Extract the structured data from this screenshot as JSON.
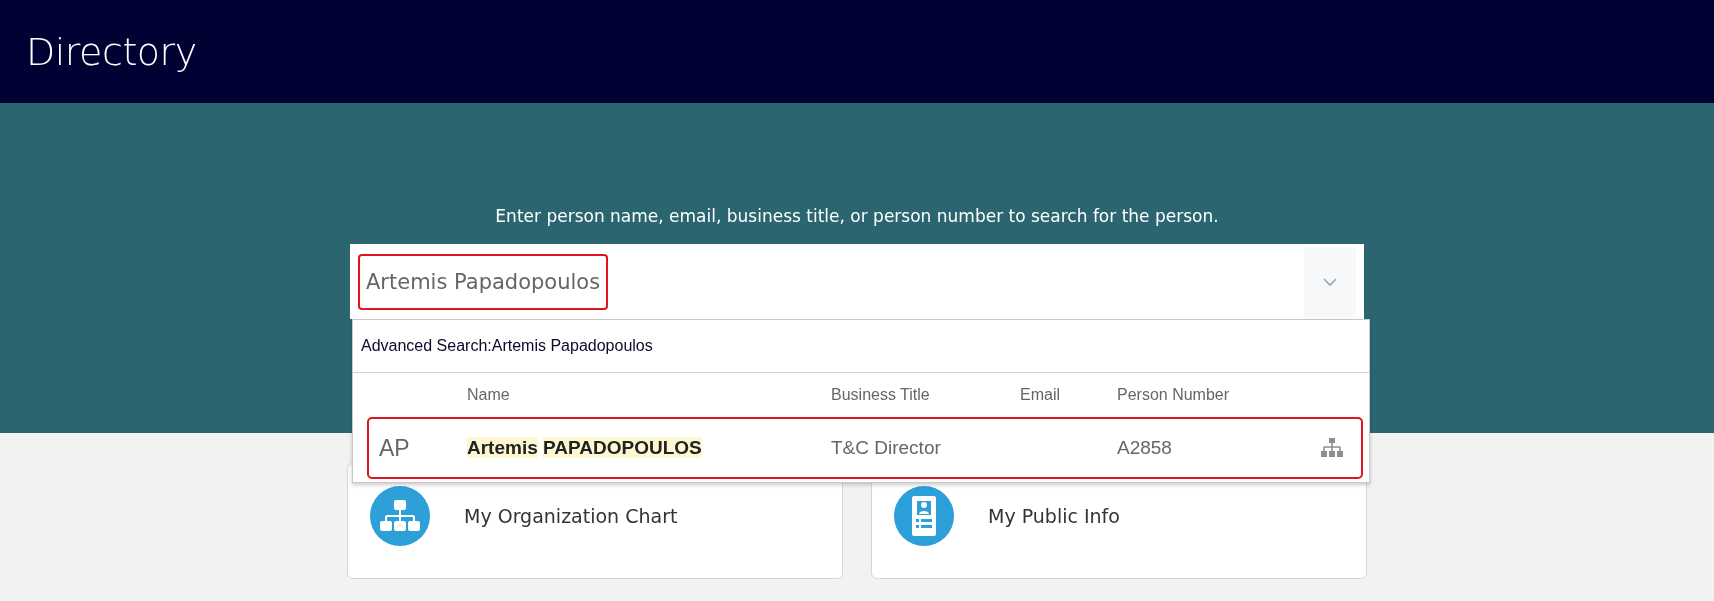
{
  "header": {
    "title": "Directory"
  },
  "search": {
    "hint": "Enter person name, email, business title, or person number to search for the person.",
    "value": "Artemis Papadopoulos",
    "expanded": true
  },
  "dropdown": {
    "advanced_search": "Advanced Search:Artemis Papadopoulos",
    "columns": [
      "Name",
      "Business Title",
      "Email",
      "Person Number"
    ],
    "rows": [
      {
        "initials": "AP",
        "name": "Artemis PAPADOPOULOS",
        "business_title": "T&C Director",
        "person_number": "A2858"
      }
    ]
  },
  "cards": [
    {
      "kind": "org",
      "label": "My Organization Chart"
    },
    {
      "kind": "info",
      "label": "My Public Info"
    }
  ]
}
